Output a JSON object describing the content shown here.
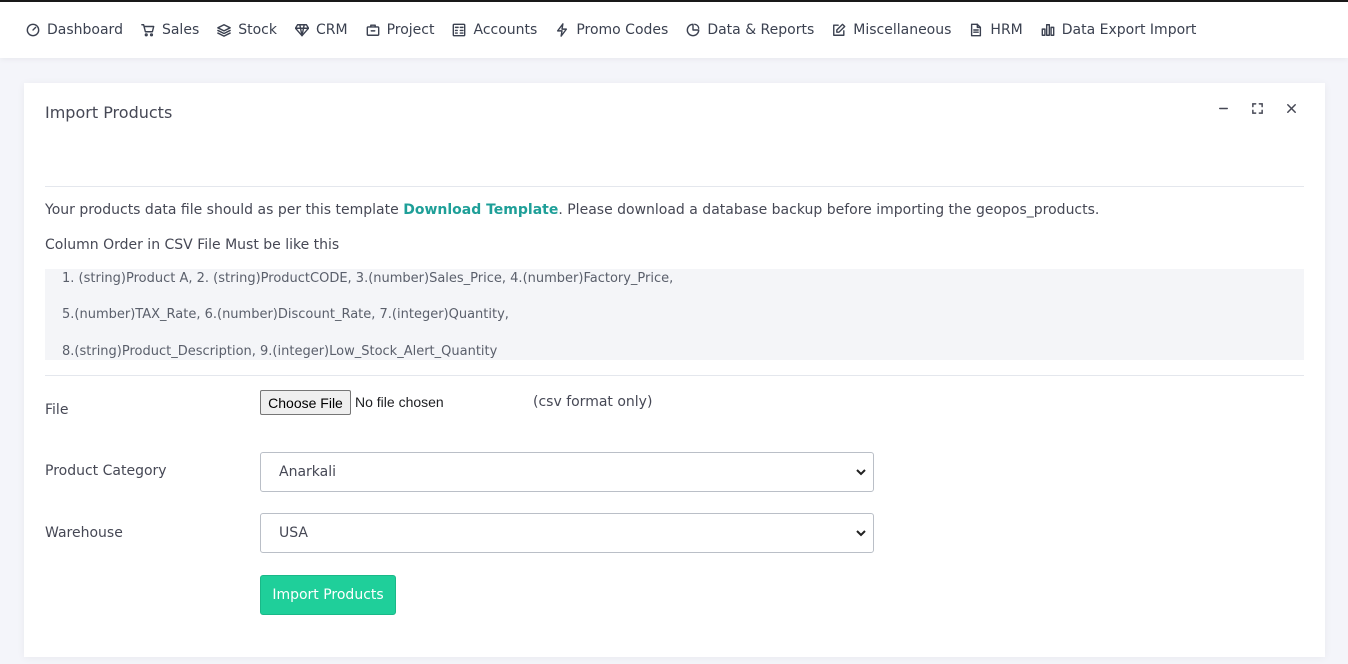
{
  "nav": {
    "items": [
      {
        "label": "Dashboard",
        "icon": "dashboard-icon"
      },
      {
        "label": "Sales",
        "icon": "cart-icon"
      },
      {
        "label": "Stock",
        "icon": "layers-icon"
      },
      {
        "label": "CRM",
        "icon": "diamond-icon"
      },
      {
        "label": "Project",
        "icon": "briefcase-icon"
      },
      {
        "label": "Accounts",
        "icon": "calculator-icon"
      },
      {
        "label": "Promo Codes",
        "icon": "zap-icon"
      },
      {
        "label": "Data & Reports",
        "icon": "pie-chart-icon"
      },
      {
        "label": "Miscellaneous",
        "icon": "edit-icon"
      },
      {
        "label": "HRM",
        "icon": "file-icon"
      },
      {
        "label": "Data Export Import",
        "icon": "bar-chart-icon"
      }
    ]
  },
  "card": {
    "title": "Import Products",
    "intro_before": "Your products data file should as per this template ",
    "intro_link": "Download Template",
    "intro_after": ". Please download a database backup before importing the geopos_products.",
    "order_label": "Column Order in CSV File Must be like this",
    "code_lines": [
      "1. (string)Product A, 2. (string)ProductCODE, 3.(number)Sales_Price, 4.(number)Factory_Price,",
      "5.(number)TAX_Rate, 6.(number)Discount_Rate, 7.(integer)Quantity,",
      "8.(string)Product_Description, 9.(integer)Low_Stock_Alert_Quantity"
    ]
  },
  "form": {
    "file_label": "File",
    "file_button": "Choose File",
    "file_status": "No file chosen",
    "file_hint": "(csv format only)",
    "category_label": "Product Category",
    "category_value": "Anarkali",
    "warehouse_label": "Warehouse",
    "warehouse_value": "USA",
    "submit_label": "Import Products"
  },
  "colors": {
    "link": "#1e9f98",
    "primary_button": "#1fcf9a"
  }
}
